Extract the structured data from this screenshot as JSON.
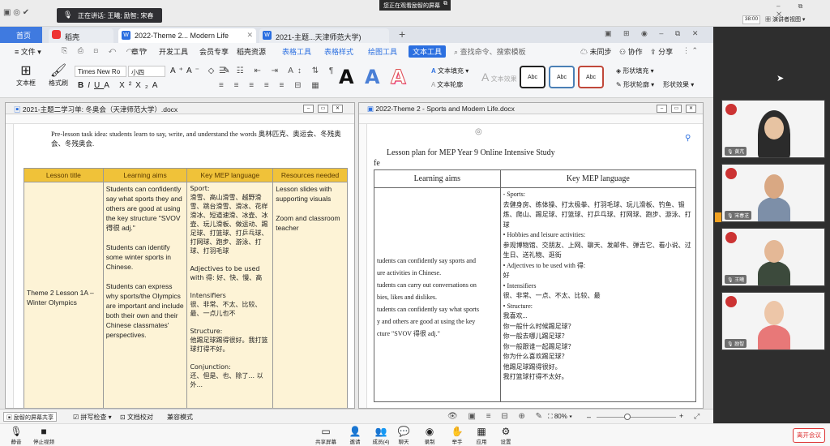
{
  "system": {
    "speaking": "正在讲话: 王曦; 励智; 宋春",
    "sharing_notice": "您正在观看励智的屏幕",
    "top_right_time": "38:00",
    "view_mode": "演讲者视图"
  },
  "tabs": [
    {
      "label": "首页"
    },
    {
      "label": "稻壳"
    },
    {
      "label": "2022-Theme 2... Modern Life"
    },
    {
      "label": "2021-主题...天津师范大学)"
    }
  ],
  "ribbon": {
    "menus": [
      "文件",
      "章节",
      "开发工具",
      "会员专享",
      "稻壳资源",
      "表格工具",
      "表格样式",
      "绘图工具",
      "文本工具"
    ],
    "active_menu": "文本工具",
    "search": "查找命令、搜索模板",
    "unsynced": "未同步",
    "collaborate": "协作",
    "share": "分享",
    "font_name": "Times New Ro",
    "font_size": "小四",
    "text_box": "文本框",
    "format_painter": "格式刷",
    "text_fill": "文本填充",
    "text_outline": "文本轮廓",
    "text_effect": "文本效果",
    "style_label": "Abc",
    "shape_fill": "形状填充",
    "shape_outline": "形状轮廓",
    "shape_effect": "形状效果"
  },
  "doc_left": {
    "title": "2021-主题二学习单: 冬奥会（天津师范大学）.docx",
    "intro": "Pre-lesson task idea: students learn to say, write, and understand the words  奥林匹克、奥运会、冬残奥会、冬残奥会.",
    "headers": [
      "Lesson title",
      "Learning aims",
      "Key MEP language",
      "Resources needed"
    ],
    "lesson_title": "Theme 2 Lesson 1A – Winter Olympics",
    "aims": [
      "Students can confidently say what sports they and others are good at using the key structure \"SVOV 得很 adj.\"",
      "Students can identify some winter sports in Chinese.",
      "Students can express why sports/the Olympics are important and include both their own and their Chinese classmates' perspectives."
    ],
    "key_language": {
      "sport_label": "Sport:",
      "sport_words": "滑雪、高山滑雪、越野滑雪、跳台滑雪、滑冰、花样滑冰、短道速滑、冰壶、冰壶、玩儿滑板、做运动、踢足球、打篮球、打乒乓球、打网球、跑步、游泳、打球、打羽毛球",
      "adjectives_label": "Adjectives to be used with 得: 好、快、慢、高",
      "intensifiers_label": "Intensifiers",
      "intensifiers": "很、非常、不太、比较、最、一点儿也不",
      "structure_label": "Structure:",
      "structure": "他踢足球踢得很好。我打篮球打得不好。",
      "conjunction_label": "Conjunction:",
      "conjunction": "还、但是、也、除了... 以外..."
    },
    "resources": [
      "Lesson slides with supporting visuals",
      "Zoom and classroom teacher"
    ]
  },
  "doc_right": {
    "title": "2022-Theme 2 - Sports and Modern Life.docx",
    "heading": "Lesson plan for MEP Year 9 Online Intensive Study",
    "heading2": "fe",
    "headers": [
      "Learning aims",
      "Key MEP language"
    ],
    "aims": [
      "tudents can confidently say sports and",
      "ure activities in Chinese.",
      "tudents can carry out conversations on",
      "bies, likes and dislikes.",
      "tudents can confidently say what sports",
      "y and others are good at using the key",
      "cture \"SVOV 得很 adj.\""
    ],
    "lang": [
      "- Sports:",
      "去健身房、练体操、打太极拳、打羽毛球、玩儿滑板、钓鱼、锻炼、爬山、踢足球、打篮球、打乒乓球、打网球、跑步、游泳、打球",
      "•  Hobbies and leisure activities:",
      "参观博物馆、交朋友、上网、聊天、发邮件、弹吉它、看小说、过生日、送礼物、逛街",
      "•  Adjectives to be used with 得:",
      "好",
      "•  Intensifiers",
      "很、非常、一点、不太、比较、最",
      "•  Structure:",
      "我喜欢...",
      "你一般什么时候踢足球？",
      "你一般去哪儿踢足球？",
      "你一般跟谁一起踢足球？",
      "你为什么喜欢踢足球？",
      "他踢足球踢得很好。",
      "我打篮球打得不太好。"
    ]
  },
  "statusbar": {
    "spell_check": "拼写检查",
    "proof": "文档校对",
    "compat": "兼容模式",
    "zoom": "80%",
    "sharing_label": "励智的屏幕共享"
  },
  "participants": [
    {
      "name": "黄芃"
    },
    {
      "name": "宋春芝"
    },
    {
      "name": "王曦"
    },
    {
      "name": "励智"
    }
  ],
  "meeting_bar": [
    {
      "label": "静音"
    },
    {
      "label": "停止视频"
    },
    {
      "label": "共享屏幕"
    },
    {
      "label": "邀请"
    },
    {
      "label": "成员(4)"
    },
    {
      "label": "聊天"
    },
    {
      "label": "录制"
    },
    {
      "label": "举手"
    },
    {
      "label": "应用"
    },
    {
      "label": "设置"
    }
  ],
  "leave_label": "离开会议",
  "colors": {
    "accent": "#2b6fe0",
    "table_header": "#f0c239",
    "table_cell": "#fdf3d6",
    "leave": "#dd3333"
  }
}
